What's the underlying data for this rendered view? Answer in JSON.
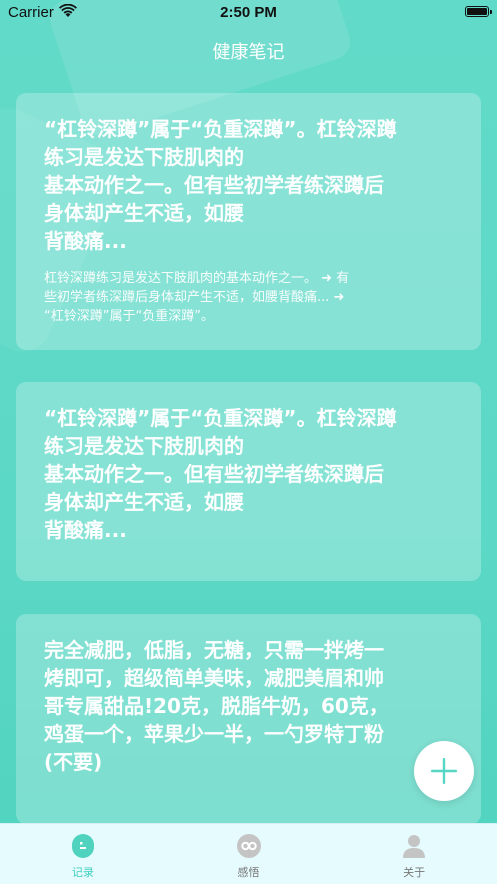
{
  "status_bar": {
    "carrier": "Carrier",
    "time": "2:50 PM"
  },
  "nav": {
    "title": "健康笔记"
  },
  "notes": [
    {
      "title": "“杠铃深蹲”属于“负重深蹲”。杠铃深蹲\n练习是发达下肢肌肉的\n基本动作之一。但有些初学者练深蹲后\n身体却产生不适，如腰\n背酸痛...",
      "summary": "杠铃深蹲练习是发达下肢肌肉的基本动作之一。 ➜ 有\n些初学者练深蹲后身体却产生不适，如腰背酸痛... ➜\n“杠铃深蹲”属于“负重深蹲”。"
    },
    {
      "title": "“杠铃深蹲”属于“负重深蹲”。杠铃深蹲\n练习是发达下肢肌肉的\n基本动作之一。但有些初学者练深蹲后\n身体却产生不适，如腰\n背酸痛..."
    },
    {
      "title": "完全减肥，低脂，无糖，只需一拌烤一\n烤即可，超级简单美味，减肥美眉和帅\n哥专属甜品!20克，脱脂牛奶，60克，\n鸡蛋一个，苹果少一半，一勺罗特丁粉\n(不要)"
    }
  ],
  "fab": {
    "icon": "plus-icon"
  },
  "tabs": [
    {
      "label": "记录",
      "icon": "record-icon",
      "active": true
    },
    {
      "label": "感悟",
      "icon": "insight-icon",
      "active": false
    },
    {
      "label": "关于",
      "icon": "person-icon",
      "active": false
    }
  ],
  "colors": {
    "accent": "#3fcfbd",
    "background": "#5cd8c6",
    "tabbar": "#e6fbfd",
    "inactive_icon": "#bdbdbd"
  }
}
